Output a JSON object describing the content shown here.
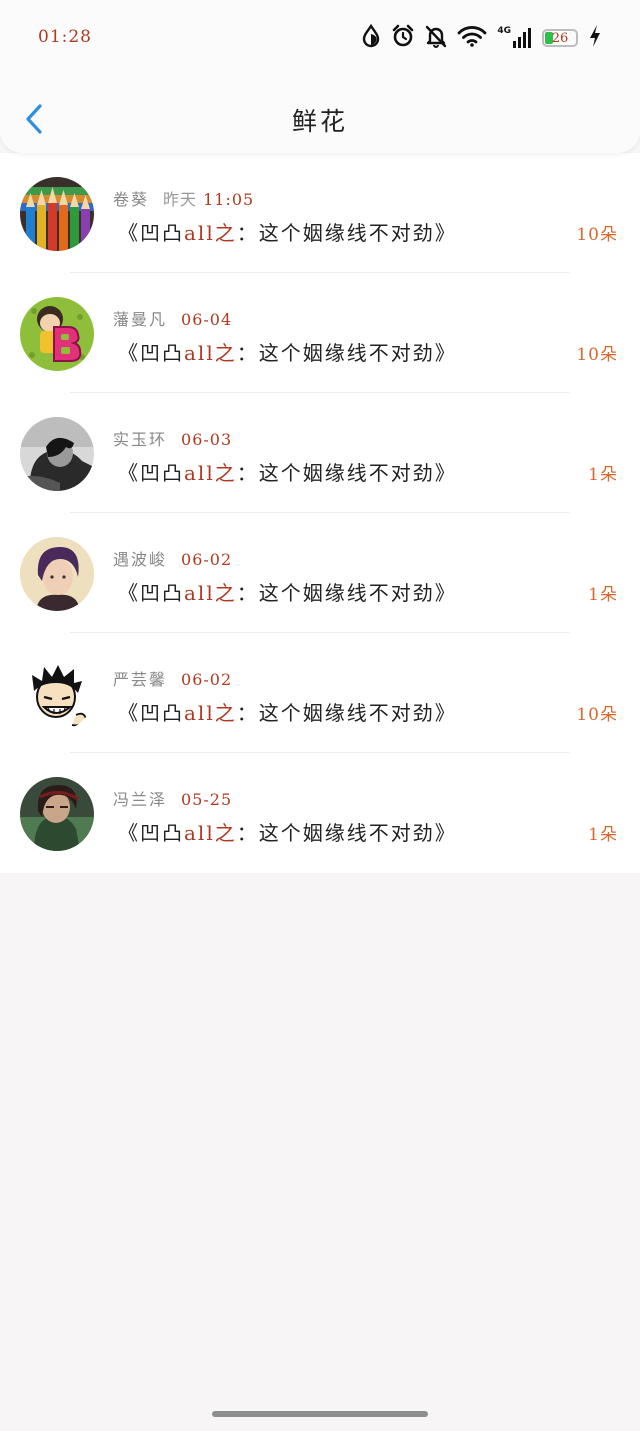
{
  "status_bar": {
    "time": "01:28",
    "network": "4G",
    "battery_level": "26",
    "icons": [
      "data-saver-icon",
      "alarm-icon",
      "muted-bell-icon",
      "wifi-icon",
      "signal-icon",
      "battery-icon",
      "charging-icon"
    ]
  },
  "header": {
    "title": "鲜花",
    "back_icon": "chevron-left-icon"
  },
  "colors": {
    "accent": "#b0391f",
    "count": "#d9682f",
    "back": "#2e8fe0"
  },
  "records": [
    {
      "name": "卷葵",
      "relative": "昨天",
      "date": "11:05",
      "book_prefix": "《凹凸",
      "book_accent": "all之",
      "book_suffix": "：这个姻缘线不对劲》",
      "count": "10朵",
      "avatar": "pencils-avatar"
    },
    {
      "name": "藩曼凡",
      "relative": "",
      "date": "06-04",
      "book_prefix": "《凹凸",
      "book_accent": "all之",
      "book_suffix": "：这个姻缘线不对劲》",
      "count": "10朵",
      "avatar": "letter-b-avatar"
    },
    {
      "name": "实玉环",
      "relative": "",
      "date": "06-03",
      "book_prefix": "《凹凸",
      "book_accent": "all之",
      "book_suffix": "：这个姻缘线不对劲》",
      "count": "1朵",
      "avatar": "bw-photo-avatar"
    },
    {
      "name": "遇波峻",
      "relative": "",
      "date": "06-02",
      "book_prefix": "《凹凸",
      "book_accent": "all之",
      "book_suffix": "：这个姻缘线不对劲》",
      "count": "1朵",
      "avatar": "portrait-avatar"
    },
    {
      "name": "严芸馨",
      "relative": "",
      "date": "06-02",
      "book_prefix": "《凹凸",
      "book_accent": "all之",
      "book_suffix": "：这个姻缘线不对劲》",
      "count": "10朵",
      "avatar": "cartoon-avatar"
    },
    {
      "name": "冯兰泽",
      "relative": "",
      "date": "05-25",
      "book_prefix": "《凹凸",
      "book_accent": "all之",
      "book_suffix": "：这个姻缘线不对劲》",
      "count": "1朵",
      "avatar": "dark-art-avatar"
    }
  ]
}
